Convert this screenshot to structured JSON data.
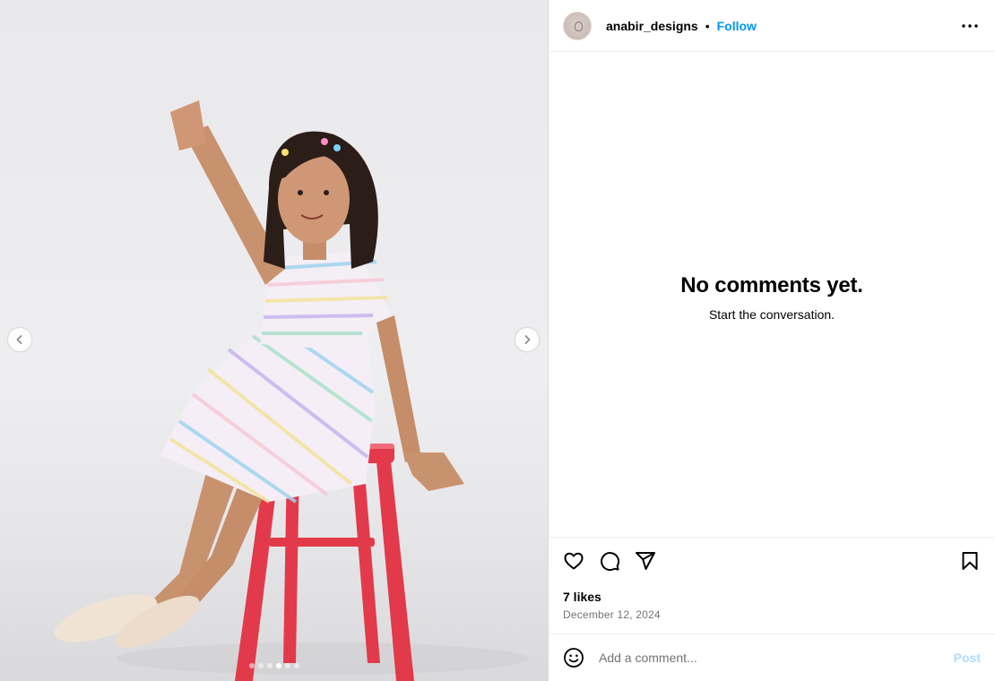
{
  "post": {
    "username": "anabir_designs",
    "separator": "•",
    "follow_label": "Follow",
    "likes": "7 likes",
    "date": "December 12, 2024"
  },
  "comments": {
    "empty_title": "No comments yet.",
    "empty_subtitle": "Start the conversation."
  },
  "composer": {
    "placeholder": "Add a comment...",
    "post_label": "Post"
  },
  "carousel": {
    "slide_count": 6,
    "active_index": 3
  },
  "icons": {
    "more": "more-horizontal-icon",
    "like": "heart-icon",
    "comment": "comment-bubble-icon",
    "share": "paper-plane-icon",
    "save": "bookmark-icon",
    "emoji": "smiley-icon",
    "prev": "chevron-left-icon",
    "next": "chevron-right-icon"
  },
  "colors": {
    "follow": "#0095f6",
    "post_disabled": "#b3dbff",
    "muted_text": "#737373",
    "stool": "#e8384a"
  }
}
